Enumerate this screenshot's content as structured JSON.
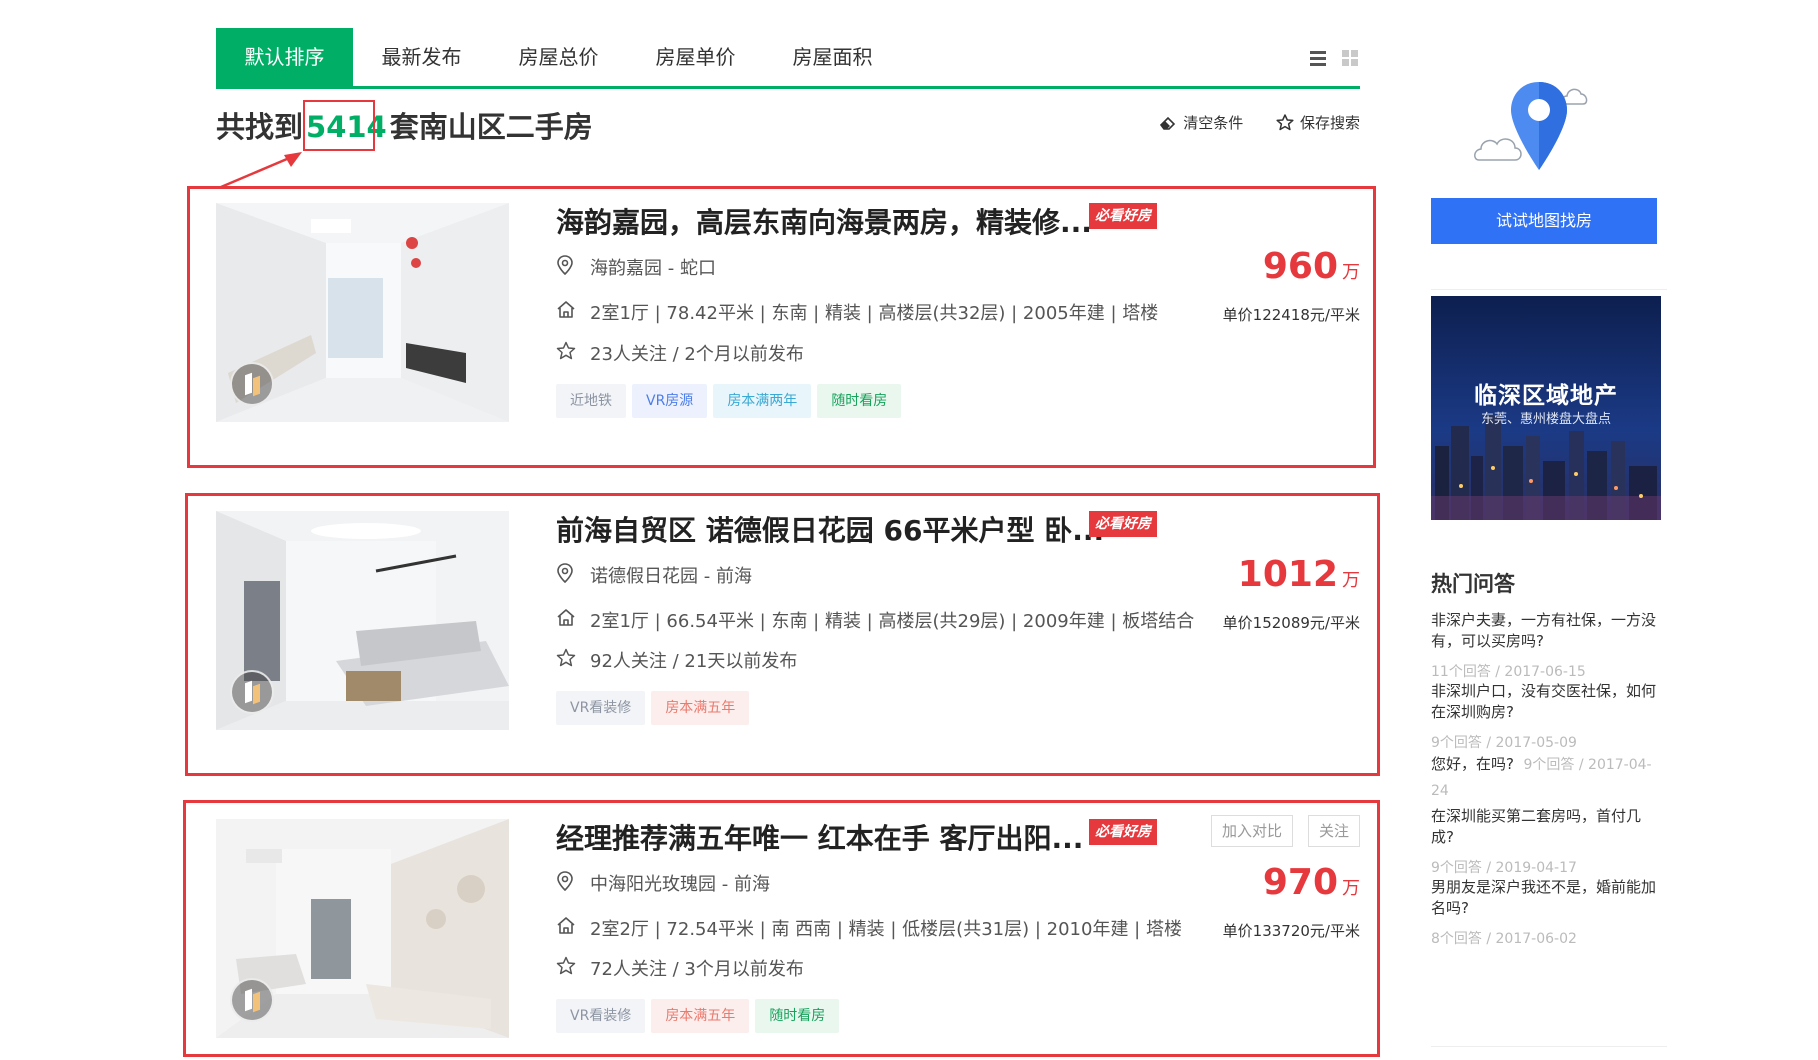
{
  "sort_tabs": [
    "默认排序",
    "最新发布",
    "房屋总价",
    "房屋单价",
    "房屋面积"
  ],
  "results": {
    "prefix": "共找到",
    "count": "5414",
    "suffix": "套南山区二手房",
    "clear_label": "清空条件",
    "save_label": "保存搜索"
  },
  "listings": [
    {
      "title": "海韵嘉园，高层东南向海景两房，精装修...",
      "badge": "必看好房",
      "community": "海韵嘉园",
      "area": "蛇口",
      "details": "2室1厅 | 78.42平米 | 东南 | 精装 | 高楼层(共32层) | 2005年建 | 塔楼",
      "follow": "23人关注 / 2个月以前发布",
      "tags": [
        {
          "text": "近地铁",
          "style": "gray"
        },
        {
          "text": "VR房源",
          "style": "blue"
        },
        {
          "text": "房本满两年",
          "style": "cyan"
        },
        {
          "text": "随时看房",
          "style": "green"
        }
      ],
      "price": "960",
      "price_unit": "万",
      "unit_price": "单价122418元/平米"
    },
    {
      "title": "前海自贸区 诺德假日花园 66平米户型 卧...",
      "badge": "必看好房",
      "community": "诺德假日花园",
      "area": "前海",
      "details": "2室1厅 | 66.54平米 | 东南 | 精装 | 高楼层(共29层) | 2009年建 | 板塔结合",
      "follow": "92人关注 / 21天以前发布",
      "tags": [
        {
          "text": "VR看装修",
          "style": "gray"
        },
        {
          "text": "房本满五年",
          "style": "red"
        }
      ],
      "price": "1012",
      "price_unit": "万",
      "unit_price": "单价152089元/平米"
    },
    {
      "title": "经理推荐满五年唯一 红本在手 客厅出阳...",
      "badge": "必看好房",
      "community": "中海阳光玫瑰园",
      "area": "前海",
      "details": "2室2厅 | 72.54平米 | 南 西南 | 精装 | 低楼层(共31层) | 2010年建 | 塔楼",
      "follow": "72人关注 / 3个月以前发布",
      "tags": [
        {
          "text": "VR看装修",
          "style": "gray"
        },
        {
          "text": "房本满五年",
          "style": "red"
        },
        {
          "text": "随时看房",
          "style": "green"
        }
      ],
      "price": "970",
      "price_unit": "万",
      "unit_price": "单价133720元/平米",
      "compare_label": "加入对比",
      "follow_label": "关注"
    }
  ],
  "sidebar": {
    "map_button": "试试地图找房",
    "ad_title": "临深区域地产",
    "ad_subtitle": "东莞、惠州楼盘大盘点",
    "qa_heading": "热门问答",
    "qa": [
      {
        "question": "非深户夫妻，一方有社保，一方没有，可以买房吗?",
        "meta": "11个回答 / 2017-06-15"
      },
      {
        "question": "非深圳户口，没有交医社保，如何在深圳购房?",
        "meta": "9个回答 / 2017-05-09"
      },
      {
        "question": "您好，在吗?",
        "meta": "9个回答 / 2017-04-24"
      },
      {
        "question": "在深圳能买第二套房吗，首付几成?",
        "meta": "9个回答 / 2019-04-17"
      },
      {
        "question": "男朋友是深户我还不是，婚前能加名吗?",
        "meta": "8个回答 / 2017-06-02"
      }
    ]
  },
  "colors": {
    "brand_green": "#00ae66",
    "price_red": "#e5393d",
    "map_blue": "#3072f6"
  },
  "icons": [
    "list-view-icon",
    "grid-view-icon",
    "eraser-icon",
    "star-icon",
    "location-pin-icon",
    "house-icon",
    "vr-icon",
    "map-pin-cloud-icon"
  ]
}
